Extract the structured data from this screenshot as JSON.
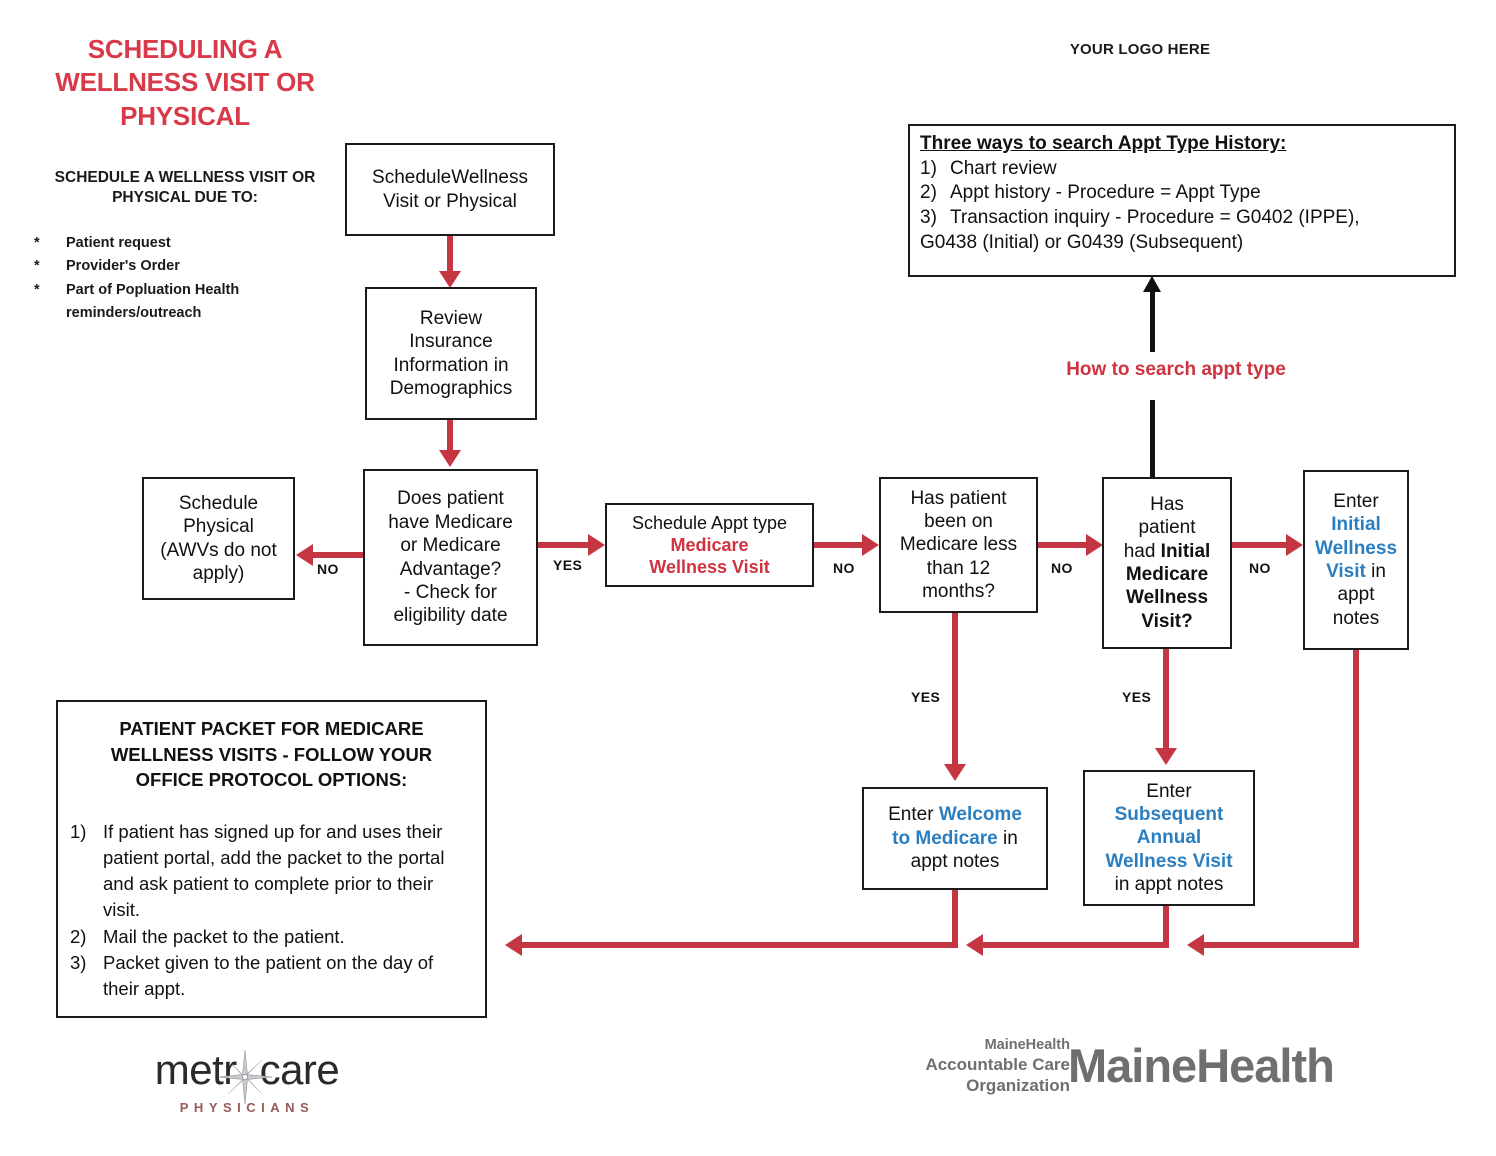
{
  "header": {
    "title": "SCHEDULING A WELLNESS VISIT OR PHYSICAL",
    "subtitle": "SCHEDULE A WELLNESS VISIT OR PHYSICAL DUE TO:",
    "logo_placeholder": "YOUR LOGO HERE",
    "title_color": "#d83a49"
  },
  "reasons": {
    "bullet_marker": "*",
    "items": [
      "Patient request",
      "Provider's Order",
      "Part of Popluation Health reminders/outreach"
    ]
  },
  "three_ways": {
    "heading": "Three ways to search Appt Type History:",
    "items": [
      {
        "num": "1)",
        "text": "Chart review"
      },
      {
        "num": "2)",
        "text": "Appt history - Procedure = Appt Type"
      },
      {
        "num": "3)",
        "text": "Transaction inquiry - Procedure = G0402 (IPPE),"
      }
    ],
    "continuation": "G0438 (Initial) or G0439 (Subsequent)"
  },
  "how_to_search_label": "How to search appt type",
  "nodes": {
    "schedule_wellness": {
      "line1": "ScheduleWellness",
      "line2": "Visit or Physical"
    },
    "review_insurance": {
      "line1": "Review",
      "line2": "Insurance",
      "line3": "Information in",
      "line4": "Demographics"
    },
    "does_patient_medicare": {
      "line1": "Does patient",
      "line2": "have Medicare",
      "line3": "or Medicare",
      "line4": "Advantage?",
      "line5": "- Check for",
      "line6": "eligibility date"
    },
    "schedule_physical": {
      "line1": "Schedule",
      "line2": "Physical",
      "line3": "(AWVs do not",
      "line4": "apply)"
    },
    "schedule_appt_type": {
      "line1": "Schedule Appt type",
      "line2": "Medicare",
      "line3": "Wellness Visit"
    },
    "has_been_on_medicare": {
      "line1": "Has patient",
      "line2": "been on",
      "line3": "Medicare less",
      "line4": "than 12",
      "line5": "months?"
    },
    "has_had_initial": {
      "line1": "Has",
      "line2": "patient",
      "line3_pre": "had ",
      "line3_bold": "Initial",
      "line4_bold": "Medicare",
      "line5_bold": "Wellness",
      "line6_bold": "Visit?"
    },
    "enter_initial": {
      "line1": "Enter",
      "highlight1": "Initial",
      "highlight2": "Wellness",
      "highlight3": "Visit",
      "after3": " in",
      "line5": "appt",
      "line6": "notes"
    },
    "enter_welcome": {
      "pre": "Enter ",
      "highlight1": "Welcome",
      "highlight2": "to Medicare",
      "after2": " in",
      "line3": "appt notes"
    },
    "enter_subsequent": {
      "line1": "Enter",
      "highlight1": "Subsequent",
      "highlight2": "Annual",
      "highlight3": "Wellness Visit",
      "line5": "in appt notes"
    }
  },
  "edge_labels": {
    "no_left": "NO",
    "yes_right": "YES",
    "no_after_appt": "NO",
    "no_after_12mo": "NO",
    "no_after_initial": "NO",
    "yes_down_12mo": "YES",
    "yes_down_initial": "YES"
  },
  "patient_packet": {
    "heading_line1": "PATIENT PACKET FOR MEDICARE",
    "heading_line2": "WELLNESS VISITS - FOLLOW YOUR",
    "heading_line3": "OFFICE PROTOCOL OPTIONS:",
    "options": [
      {
        "num": "1)",
        "text": "If patient has signed up for and uses their patient portal, add the packet to the portal and ask patient to complete prior to their visit."
      },
      {
        "num": "2)",
        "text": "Mail the packet to the patient."
      },
      {
        "num": "3)",
        "text": "Packet given to the patient on the day of their appt."
      }
    ]
  },
  "footer": {
    "metrocare_word_a": "metr",
    "metrocare_word_gap": "o",
    "metrocare_word_b": "care",
    "metrocare_sub": "PHYSICIANS",
    "mh_aco_line1": "MaineHealth",
    "mh_aco_line2": "Accountable Care",
    "mh_aco_line3": "Organization",
    "mainehealth": "MaineHealth"
  },
  "colors": {
    "red_accent": "#cf3340",
    "arrow_red": "#c43642",
    "blue_accent": "#2b7fc0",
    "black": "#111111",
    "gray_logo": "#6f6f6f"
  }
}
